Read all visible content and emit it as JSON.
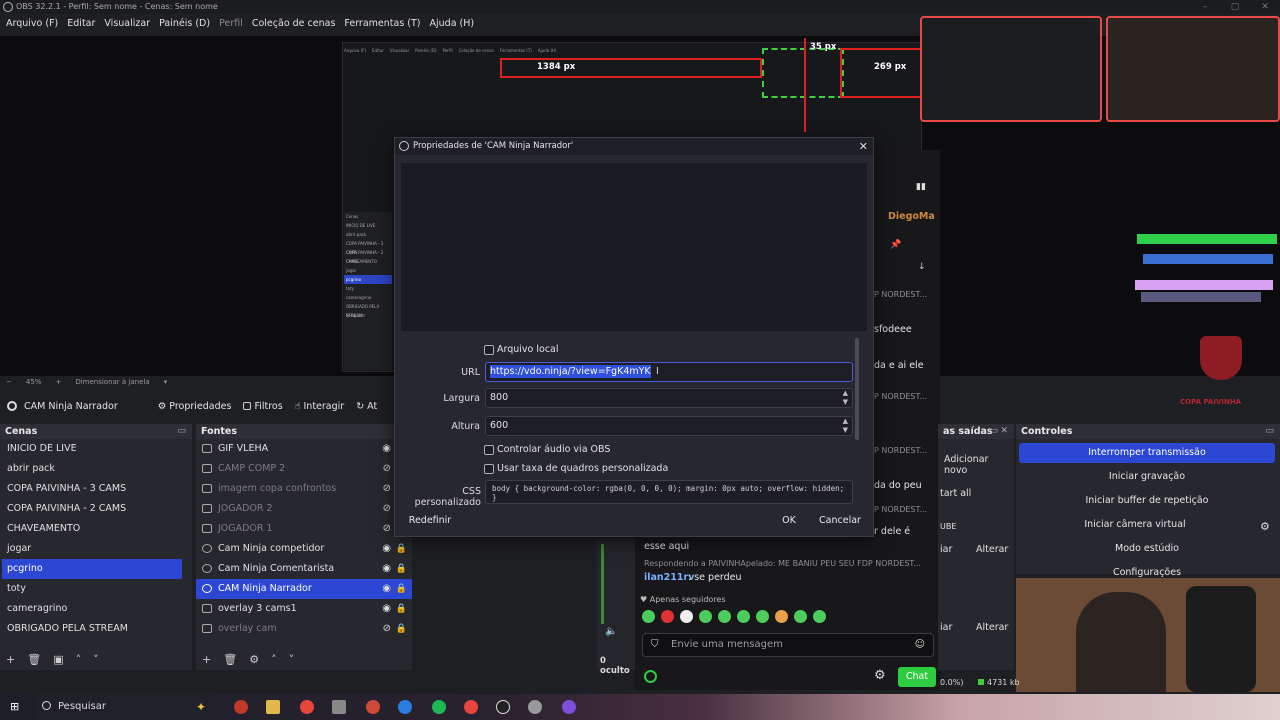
{
  "window": {
    "title": "OBS 32.2.1 - Perfil: Sem nome - Cenas: Sem nome"
  },
  "menu": [
    "Arquivo (F)",
    "Editar",
    "Visualizar",
    "Painéis (D)",
    "Perfil",
    "Coleção de cenas",
    "Ferramentas (T)",
    "Ajuda (H)"
  ],
  "preview": {
    "labels": {
      "width_px": "1384 px",
      "top_px": "35 px",
      "right_px": "269 px"
    },
    "inner_menu": [
      "Arquivo (F)",
      "Editar",
      "Visualizar",
      "Painéis (D)",
      "Perfil",
      "Coleção de cenas",
      "Ferramentas (T)",
      "Ajuda (H)"
    ],
    "inner_scenes": [
      "Cenas",
      "INICIO DE LIVE",
      "abrir pack",
      "COPA PAIVINHA - 3 CAMS",
      "COPA PAIVINHA - 2 CAMS",
      "CHAVEAMENTO",
      "jogar",
      "pcgrino",
      "toty",
      "cameragrino",
      "OBRIGADO PELA STREAM"
    ],
    "inner_search": "Pesquisar",
    "logo_text": "COPA PAIVINHA"
  },
  "status": {
    "zoom": "45%",
    "scale_mode": "Dimensionar à janela"
  },
  "source_toolbar": {
    "selected_source": "CAM Ninja Narrador",
    "properties": "Propriedades",
    "filters": "Filtros",
    "interact": "Interagir",
    "more": "At"
  },
  "scenes": {
    "title": "Cenas",
    "items": [
      "INICIO DE LIVE",
      "abrir pack",
      "COPA PAIVINHA - 3 CAMS",
      "COPA PAIVINHA - 2 CAMS",
      "CHAVEAMENTO",
      "jogar",
      "pcgrino",
      "toty",
      "cameragrino",
      "OBRIGADO PELA STREAM"
    ],
    "selected_index": 6
  },
  "sources": {
    "title": "Fontes",
    "items": [
      {
        "name": "GIF VLEHA",
        "visible": true
      },
      {
        "name": "CAMP COMP 2",
        "visible": false
      },
      {
        "name": "imagem copa confrontos",
        "visible": false
      },
      {
        "name": "JOGADOR 2",
        "visible": false
      },
      {
        "name": "JOGADOR 1",
        "visible": false
      },
      {
        "name": "Cam Ninja competidor",
        "visible": true
      },
      {
        "name": "Cam Ninja Comentarista",
        "visible": true
      },
      {
        "name": "CAM Ninja Narrador",
        "visible": true
      },
      {
        "name": "overlay 3 cams1",
        "visible": true
      },
      {
        "name": "overlay cam",
        "visible": false
      }
    ],
    "selected_index": 7
  },
  "outputs": {
    "title": "as saídas",
    "add_new": "Adicionar novo",
    "start_all": "tart all",
    "row_labels": [
      "UBE",
      "iar",
      "Alterar",
      "iar",
      "Alterar"
    ],
    "hidden_count": "0 oculto"
  },
  "controls": {
    "title": "Controles",
    "buttons": [
      "Interromper transmissão",
      "Iniciar gravação",
      "Iniciar buffer de repetição",
      "Iniciar câmera virtual",
      "Modo estúdio",
      "Configurações"
    ],
    "stats": {
      "cpu": "0.0%)",
      "bitrate": "4731 kb"
    }
  },
  "chat": {
    "user_top": "DiegoMa",
    "replies": [
      "P NORDEST...",
      "P NORDEST...",
      "P NORDEST...",
      "P NORDEST..."
    ],
    "fragments": [
      "sfodeee",
      "da e ai ele",
      "da do peu",
      "r dele é",
      "esse aqui"
    ],
    "reply_to": "Respondendo a PAIVINHApelado: ME BANIU PEU SEU FDP NORDEST...",
    "last_user": "ilan211rv",
    "last_text": ": se perdeu",
    "mode": "Apenas seguidores",
    "placeholder": "Envie uma mensagem",
    "send_label": "Chat"
  },
  "dialog": {
    "title": "Propriedades de 'CAM Ninja Narrador'",
    "local_file": "Arquivo local",
    "url_label": "URL",
    "url_value": "https://vdo.ninja/?view=FgK4mYK",
    "width_label": "Largura",
    "width_value": "800",
    "height_label": "Altura",
    "height_value": "600",
    "audio_label": "Controlar áudio via OBS",
    "fps_label": "Usar taxa de quadros personalizada",
    "css_label": "CSS personalizado",
    "css_value": "body { background-color: rgba(0, 0, 0, 0); margin: 0px auto; overflow: hidden; }",
    "reset": "Redefinir",
    "ok": "OK",
    "cancel": "Cancelar"
  },
  "taskbar": {
    "search": "Pesquisar"
  },
  "colors": {
    "accent": "#2b47d4",
    "chat_green": "#2ecc40",
    "guide_red": "#e02020"
  }
}
